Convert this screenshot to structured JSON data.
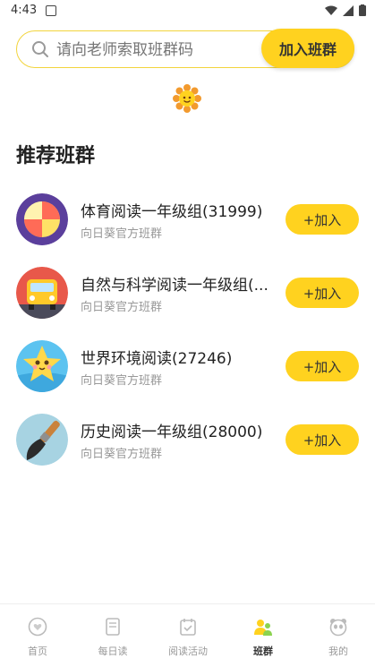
{
  "status": {
    "time": "4:43"
  },
  "search": {
    "placeholder": "请向老师索取班群码",
    "join_label": "加入班群"
  },
  "section": {
    "title": "推荐班群"
  },
  "groups": [
    {
      "name": "体育阅读一年级组(31999)",
      "sub": "向日葵官方班群",
      "add": "+加入",
      "icon": "beach-ball-icon"
    },
    {
      "name": "自然与科学阅读一年级组(...",
      "sub": "向日葵官方班群",
      "add": "+加入",
      "icon": "car-icon"
    },
    {
      "name": "世界环境阅读(27246)",
      "sub": "向日葵官方班群",
      "add": "+加入",
      "icon": "star-character-icon"
    },
    {
      "name": "历史阅读一年级组(28000)",
      "sub": "向日葵官方班群",
      "add": "+加入",
      "icon": "brush-icon"
    }
  ],
  "tabs": [
    {
      "label": "首页",
      "icon": "heart-home-icon"
    },
    {
      "label": "每日读",
      "icon": "book-icon"
    },
    {
      "label": "阅读活动",
      "icon": "calendar-check-icon"
    },
    {
      "label": "班群",
      "icon": "group-icon",
      "active": true
    },
    {
      "label": "我的",
      "icon": "panda-face-icon"
    }
  ],
  "colors": {
    "accent": "#ffd21f",
    "search_border": "#f2d43c"
  }
}
